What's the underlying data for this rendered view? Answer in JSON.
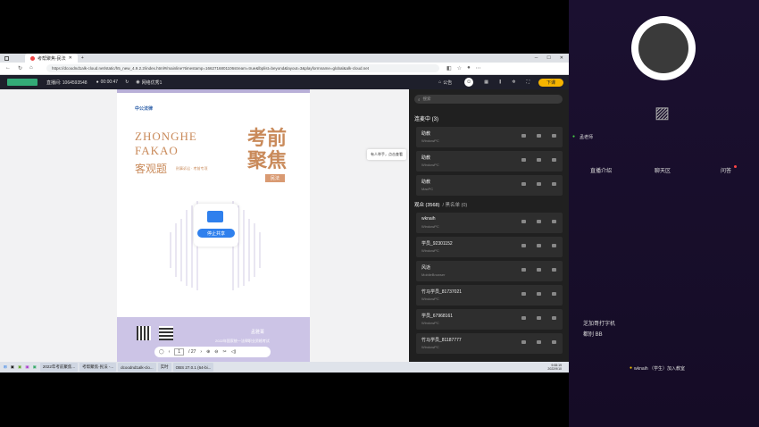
{
  "browser": {
    "tab_title": "考帮聚焦-民法",
    "url": "https://dcoodnd1alk-cloud.net/static/h5_new_4.9.2.2/index.html#/mainline?timestamp=1662716801106stream=true&lbplist=beyond&layout=3&playformname=global&alk-cloud.net"
  },
  "appbar": {
    "room_label": "直播间: 1064593548",
    "timer": "00:00:47",
    "network": "网络优秀1",
    "notice": "公告",
    "stop_label": "下课"
  },
  "book": {
    "brand": "中公法律",
    "latin1": "ZHONGHE",
    "latin2": "FAKAO",
    "subtitle": "客观题",
    "subtitle_small": "刑事诉讼 · 考前专项",
    "big1": "考前",
    "big2": "聚焦",
    "badge": "民法",
    "share_label": "停止共享",
    "footer": "2022年国家统一法律职业资格考试",
    "teacher": "孟雅菁",
    "page_current": "1",
    "page_total": "/ 27"
  },
  "tooltip": "有人举手，点击查看",
  "panel": {
    "search_placeholder": "搜索",
    "connected_header": "连麦中 (3)",
    "connected": [
      {
        "name": "助教",
        "os": "WindowPC"
      },
      {
        "name": "助教",
        "os": "WindowPC"
      },
      {
        "name": "助教",
        "os": "MacPC"
      }
    ],
    "audience_header": "观众 (3568)",
    "blacklist": "/ 黑名单 (0)",
    "audience": [
      {
        "name": "wknaih",
        "os": "WindowPC"
      },
      {
        "name": "学员_92301152",
        "os": "WindowPC"
      },
      {
        "name": "风逝",
        "os": "MobileBrowser"
      },
      {
        "name": "竹马学员_81737021",
        "os": "WindowPC"
      },
      {
        "name": "学员_67968161",
        "os": "WindowPC"
      },
      {
        "name": "竹马学员_81187777",
        "os": "WindowPC"
      }
    ]
  },
  "taskbar": {
    "apps": [
      "2022年考前聚焦...",
      "考帮聚焦-民法 -...",
      "dcoodnd1alk-clo...",
      "实时",
      "OBS 27.0.1 (64-bi..."
    ],
    "time": "9:08:19",
    "date": "2022/9/10"
  },
  "right": {
    "teacher_label": "孟老师",
    "tabs": [
      "直播介绍",
      "聊天区",
      "问答"
    ],
    "chat_user": "芝加哥打字机",
    "chat_msg": "都别 BB",
    "join_msg": "wknaih （学生）加入教室"
  }
}
